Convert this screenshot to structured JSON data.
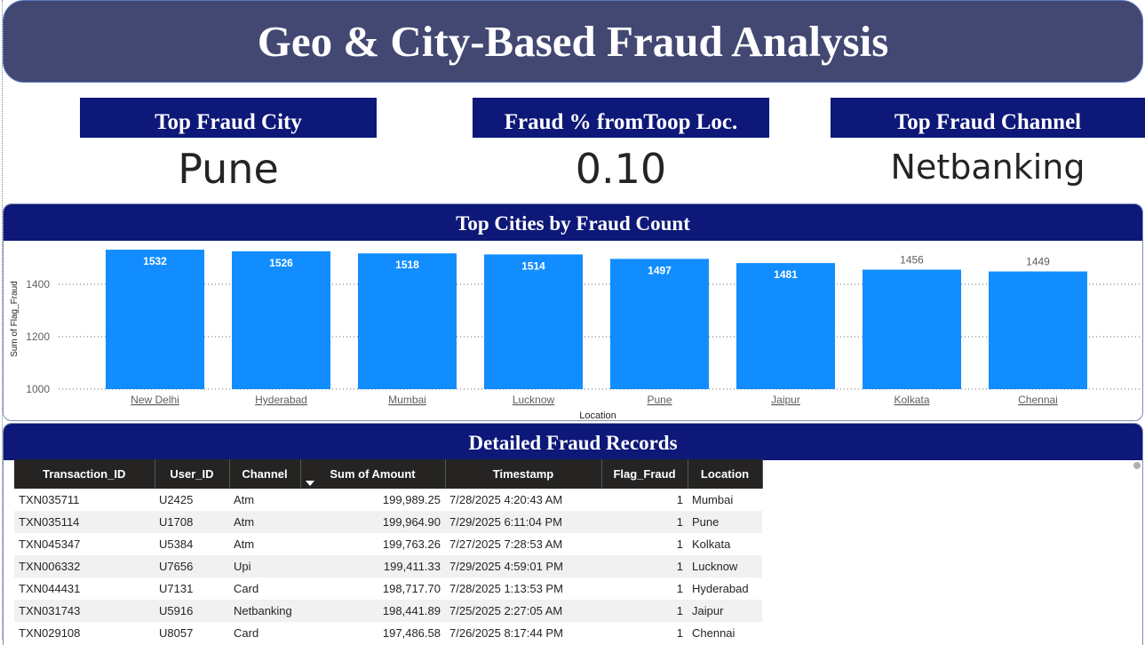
{
  "title": "Geo & City-Based Fraud Analysis",
  "kpis": [
    {
      "label": "Top Fraud City",
      "value": "Pune"
    },
    {
      "label": "Fraud % fromToop Loc.",
      "value": "0.10"
    },
    {
      "label": "Top Fraud Channel",
      "value": "Netbanking"
    }
  ],
  "chart_data": {
    "type": "bar",
    "title": "Top Cities by Fraud Count",
    "categories": [
      "New Delhi",
      "Hyderabad",
      "Mumbai",
      "Lucknow",
      "Pune",
      "Jaipur",
      "Kolkata",
      "Chennai"
    ],
    "values": [
      1532,
      1526,
      1518,
      1514,
      1497,
      1481,
      1456,
      1449
    ],
    "xlabel": "Location",
    "ylabel": "Sum of Flag_Fraud",
    "yticks": [
      1000,
      1200,
      1400
    ],
    "ylim": [
      1000,
      1550
    ],
    "bar_color": "#118dff",
    "grid": "dotted horizontal"
  },
  "table": {
    "title": "Detailed Fraud Records",
    "columns": [
      "Transaction_ID",
      "User_ID",
      "Channel",
      "Sum of Amount",
      "Timestamp",
      "Flag_Fraud",
      "Location"
    ],
    "sorted_column": "Sum of Amount",
    "rows": [
      [
        "TXN035711",
        "U2425",
        "Atm",
        "199,989.25",
        "7/28/2025 4:20:43 AM",
        "1",
        "Mumbai"
      ],
      [
        "TXN035114",
        "U1708",
        "Atm",
        "199,964.90",
        "7/29/2025 6:11:04 PM",
        "1",
        "Pune"
      ],
      [
        "TXN045347",
        "U5384",
        "Atm",
        "199,763.26",
        "7/27/2025 7:28:53 AM",
        "1",
        "Kolkata"
      ],
      [
        "TXN006332",
        "U7656",
        "Upi",
        "199,411.33",
        "7/29/2025 4:59:01 PM",
        "1",
        "Lucknow"
      ],
      [
        "TXN044431",
        "U7131",
        "Card",
        "198,717.70",
        "7/28/2025 1:13:53 PM",
        "1",
        "Hyderabad"
      ],
      [
        "TXN031743",
        "U5916",
        "Netbanking",
        "198,441.89",
        "7/25/2025 2:27:05 AM",
        "1",
        "Jaipur"
      ],
      [
        "TXN029108",
        "U8057",
        "Card",
        "197,486.58",
        "7/26/2025 8:17:44 PM",
        "1",
        "Chennai"
      ]
    ]
  },
  "colors": {
    "title_bg": "#424872",
    "header_bg": "#0d1878",
    "table_header_bg": "#252423",
    "bar": "#118dff"
  }
}
